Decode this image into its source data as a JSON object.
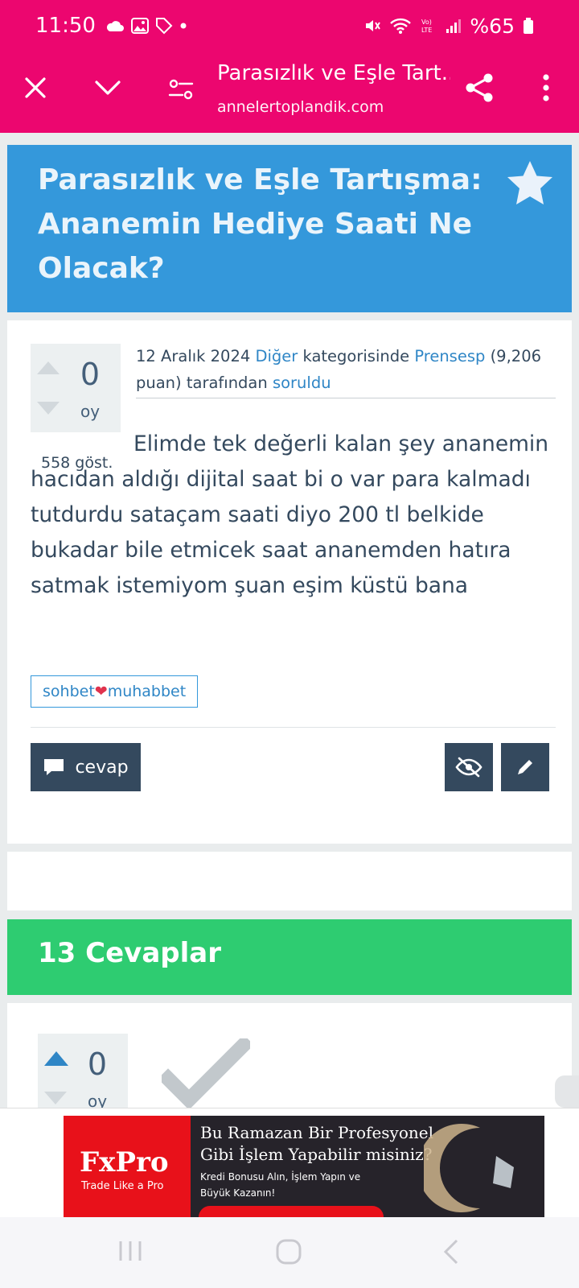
{
  "status_bar": {
    "time": "11:50",
    "battery": "%65"
  },
  "browser": {
    "tab_title": "Parasızlık ve Eşle Tart...",
    "url": "annelertoplandik.com"
  },
  "question": {
    "title": "Parasızlık ve Eşle Tartışma: Ananemin Hediye Saati Ne Olacak?",
    "votes": "0",
    "votes_label": "oy",
    "views": "558 göst.",
    "meta": {
      "date": "12 Aralık 2024",
      "category": "Diğer",
      "category_suffix": " kategorisinde ",
      "author": "Prensesp",
      "points": "(9,206 puan) tarafından ",
      "action": "soruldu"
    },
    "body": "Elimde tek değerli kalan şey ananemin hacıdan aldığı dijital saat bi o var para kalmadı tutdurdu sataçam saati diyo 200 tl belkide bukadar  bile etmicek saat ananemden hatıra satmak istemiyom şuan eşim küstü bana",
    "tag_part1": "sohbet",
    "tag_heart": "❤",
    "tag_part2": "muhabbet",
    "answer_button": "cevap"
  },
  "answers": {
    "heading": "13 Cevaplar",
    "first": {
      "votes": "0",
      "votes_label": "oy"
    }
  },
  "ad": {
    "brand": "FxPro",
    "slogan": "Trade Like a Pro",
    "headline": "Bu Ramazan Bir Profesyonel Gibi İşlem Yapabilir misiniz?",
    "subtext": "Kredi Bonusu Alın, İşlem Yapın ve Büyük Kazanın!"
  },
  "colors": {
    "browser_bar": "#ec066f",
    "question_header": "#3498db",
    "answers_header": "#2ecc71",
    "button": "#34495e",
    "link": "#2f86c6"
  }
}
